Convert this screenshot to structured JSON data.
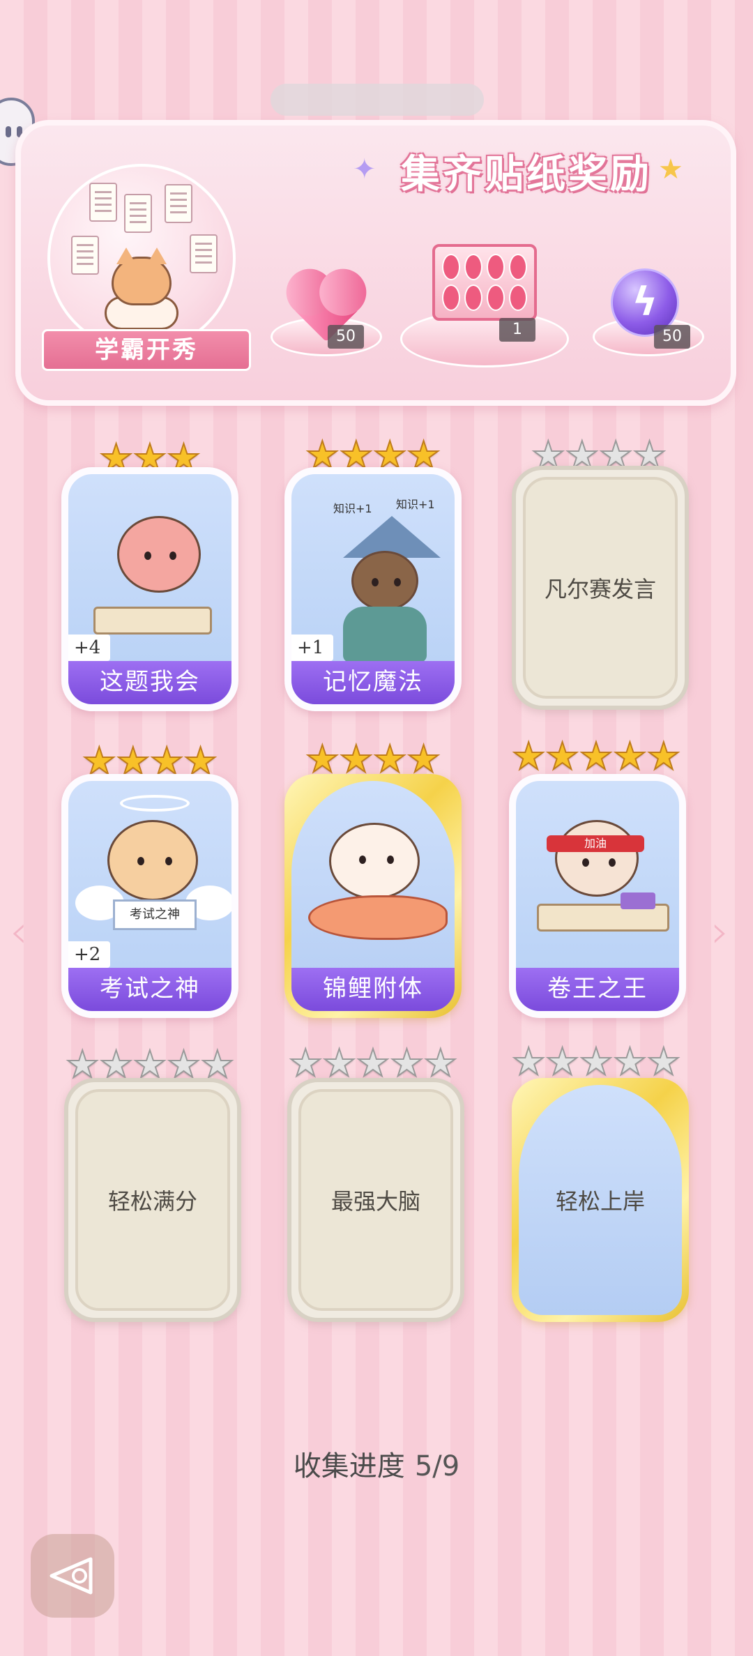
{
  "banner": {
    "title": "集齐贴纸奖励",
    "theme_label": "学霸开秀",
    "rewards": [
      {
        "icon": "pink-heart-gem-icon",
        "count": "50"
      },
      {
        "icon": "gift-box-icon",
        "count": "1"
      },
      {
        "icon": "purple-lightning-orb-icon",
        "count": "50"
      }
    ]
  },
  "cards": [
    {
      "name": "这题我会",
      "state": "owned",
      "stars": 3,
      "plus": "+4"
    },
    {
      "name": "记忆魔法",
      "state": "owned",
      "stars": 4,
      "plus": "+1"
    },
    {
      "name": "凡尔赛发言",
      "state": "locked",
      "stars": 4,
      "plus": ""
    },
    {
      "name": "考试之神",
      "state": "owned",
      "stars": 4,
      "plus": "+2"
    },
    {
      "name": "锦鲤附体",
      "state": "owned-gold",
      "stars": 4,
      "plus": ""
    },
    {
      "name": "卷王之王",
      "state": "owned",
      "stars": 5,
      "plus": ""
    },
    {
      "name": "轻松满分",
      "state": "locked",
      "stars": 5,
      "plus": ""
    },
    {
      "name": "最强大脑",
      "state": "locked",
      "stars": 5,
      "plus": ""
    },
    {
      "name": "轻松上岸",
      "state": "locked-gold",
      "stars": 5,
      "plus": ""
    }
  ],
  "card_art_text": {
    "wizard_note_1": "知识+1",
    "wizard_note_2": "知识+1",
    "angel_sign": "考试之神",
    "headband": "加油"
  },
  "progress": {
    "label": "收集进度",
    "value": "5/9"
  },
  "nav": {
    "prev_icon": "chevron-left-icon",
    "next_icon": "chevron-right-icon",
    "back_icon": "back-triangle-icon"
  },
  "colors": {
    "accent_purple": "#8b5cf0",
    "banner_pink": "#e56f93",
    "star_gold": "#f8c128",
    "star_grey": "#e4e4e4"
  }
}
